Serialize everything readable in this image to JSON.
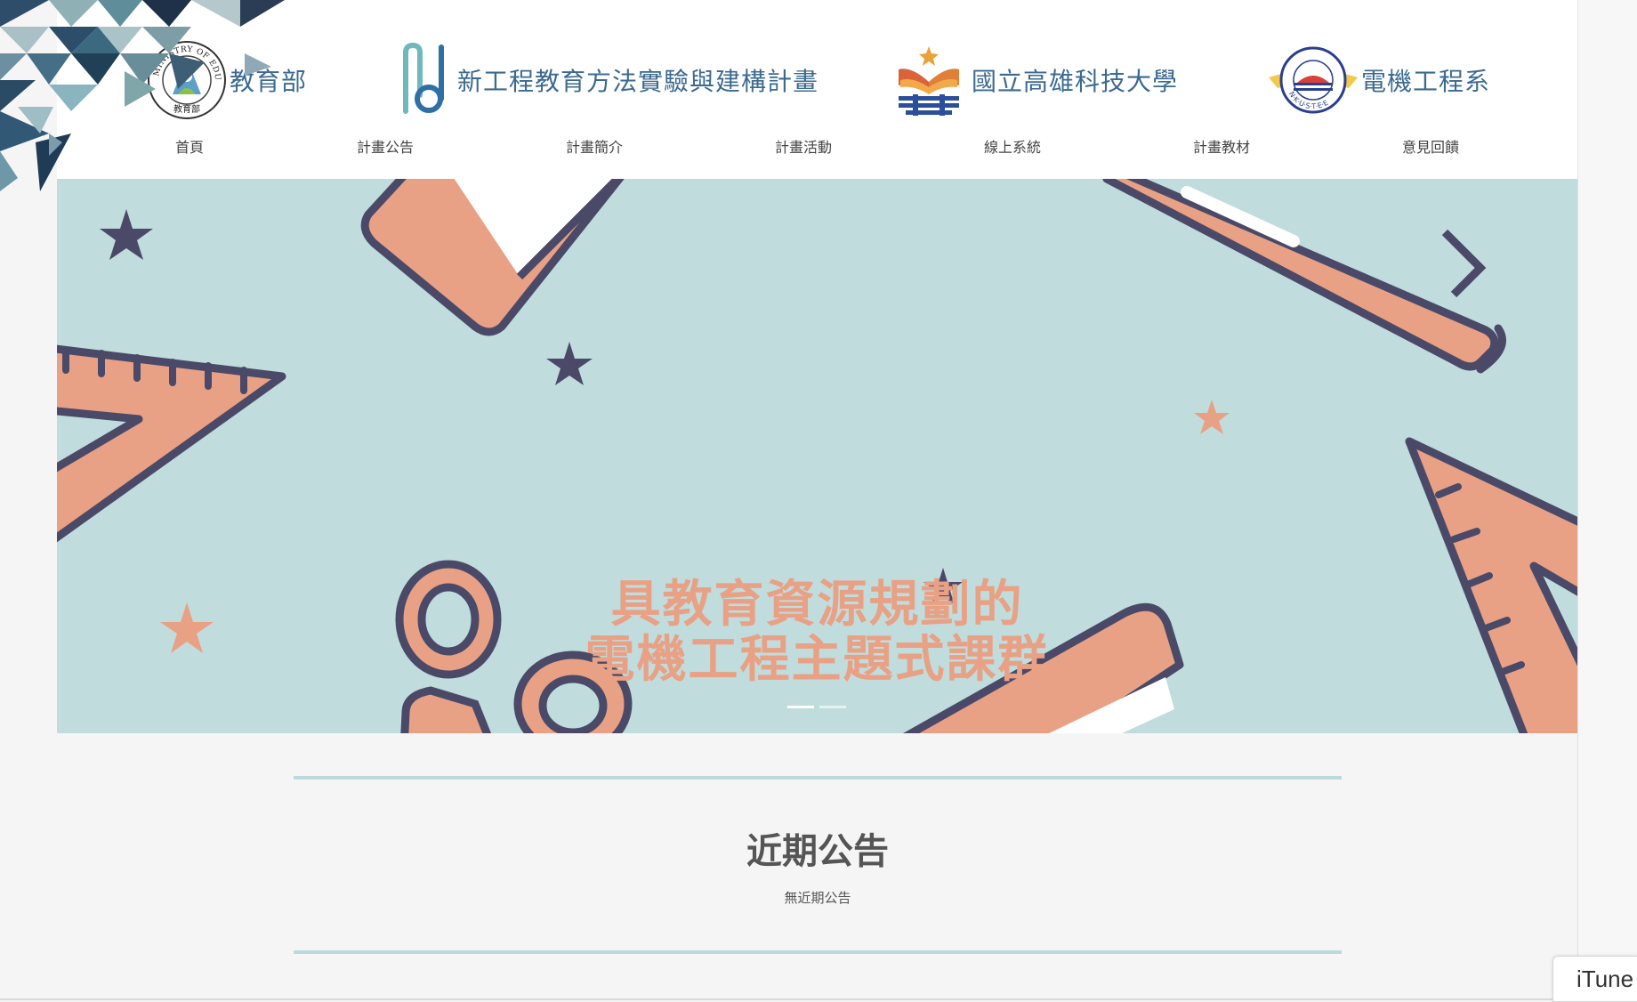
{
  "header": {
    "logos": {
      "moe": {
        "label": "教育部",
        "seal_text": "MINISTRY OF EDUCATION",
        "seal_inner_text": "教育部",
        "icon": "moe-seal-icon"
      },
      "project": {
        "label": "新工程教育方法實驗與建構計畫",
        "icon": "project-logo-icon"
      },
      "university": {
        "label": "國立高雄科技大學",
        "icon": "nkust-book-icon"
      },
      "department": {
        "label": "電機工程系",
        "seal_text": "N·K·U·S·T·E·E",
        "icon": "ee-seal-icon"
      }
    },
    "nav": [
      "首頁",
      "計畫公告",
      "計畫簡介",
      "計畫活動",
      "線上系統",
      "計畫教材",
      "意見回饋"
    ]
  },
  "banner": {
    "headline_line1": "具教育資源規劃的",
    "headline_line2": "電機工程主題式課群",
    "slides": 2,
    "active_slide": 1,
    "colors": {
      "background": "#c0dcdd",
      "accent": "#e8a184",
      "ink": "#4a4a68"
    }
  },
  "announcements": {
    "title": "近期公告",
    "empty_message": "無近期公告"
  },
  "floating_tab": {
    "label": "iTune"
  },
  "colors": {
    "brand_text": "#3c6a8f",
    "rule": "#bcdadb",
    "page_bg": "#f5f5f5"
  }
}
